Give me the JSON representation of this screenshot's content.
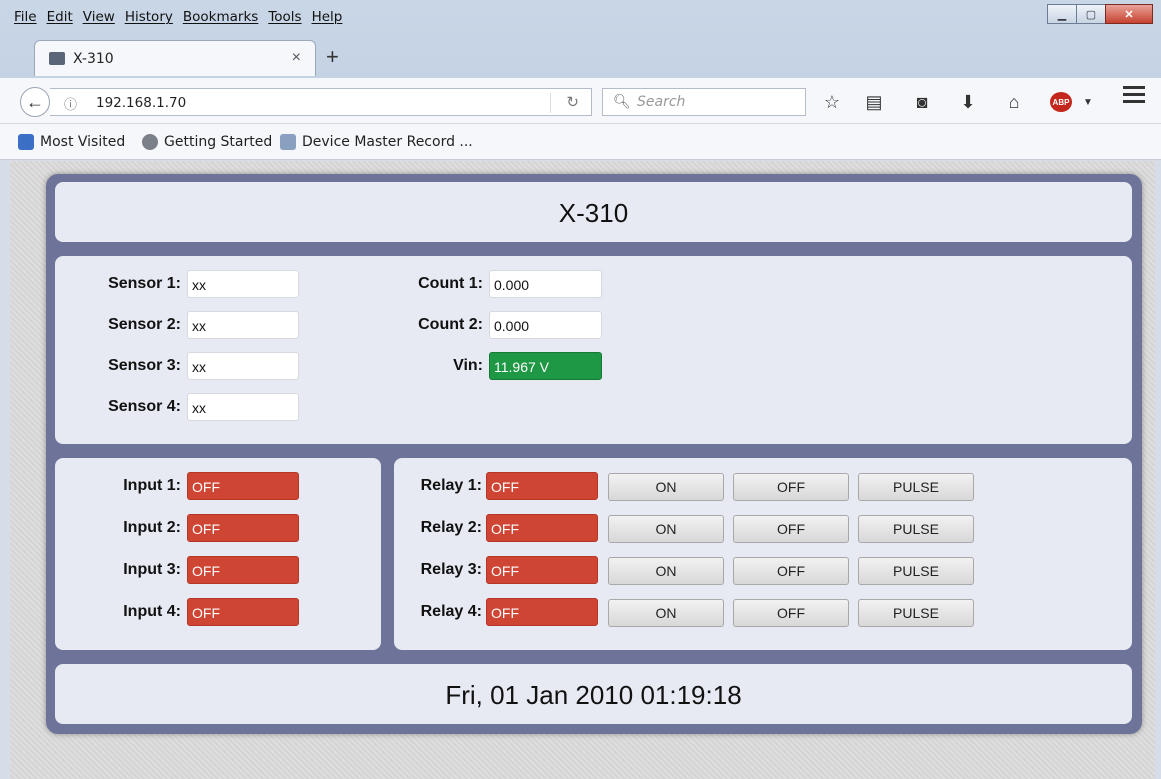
{
  "browser": {
    "menu": [
      "File",
      "Edit",
      "View",
      "History",
      "Bookmarks",
      "Tools",
      "Help"
    ],
    "tab_title": "X-310",
    "url": "192.168.1.70",
    "search_placeholder": "Search",
    "bookmarks": [
      "Most Visited",
      "Getting Started",
      "Device Master Record ..."
    ]
  },
  "device": {
    "title": "X-310",
    "sensors": [
      {
        "label": "Sensor 1:",
        "value": "xx"
      },
      {
        "label": "Sensor 2:",
        "value": "xx"
      },
      {
        "label": "Sensor 3:",
        "value": "xx"
      },
      {
        "label": "Sensor 4:",
        "value": "xx"
      }
    ],
    "counts": [
      {
        "label": "Count 1:",
        "value": "0.000"
      },
      {
        "label": "Count 2:",
        "value": "0.000"
      }
    ],
    "vin": {
      "label": "Vin:",
      "value": "11.967 V",
      "color": "#1f9845"
    },
    "inputs": [
      {
        "label": "Input 1:",
        "state": "OFF"
      },
      {
        "label": "Input 2:",
        "state": "OFF"
      },
      {
        "label": "Input 3:",
        "state": "OFF"
      },
      {
        "label": "Input 4:",
        "state": "OFF"
      }
    ],
    "relays": [
      {
        "label": "Relay 1:",
        "state": "OFF"
      },
      {
        "label": "Relay 2:",
        "state": "OFF"
      },
      {
        "label": "Relay 3:",
        "state": "OFF"
      },
      {
        "label": "Relay 4:",
        "state": "OFF"
      }
    ],
    "relay_buttons": {
      "on": "ON",
      "off": "OFF",
      "pulse": "PULSE"
    },
    "off_color": "#cf4534",
    "datetime": "Fri, 01 Jan 2010 01:19:18"
  }
}
